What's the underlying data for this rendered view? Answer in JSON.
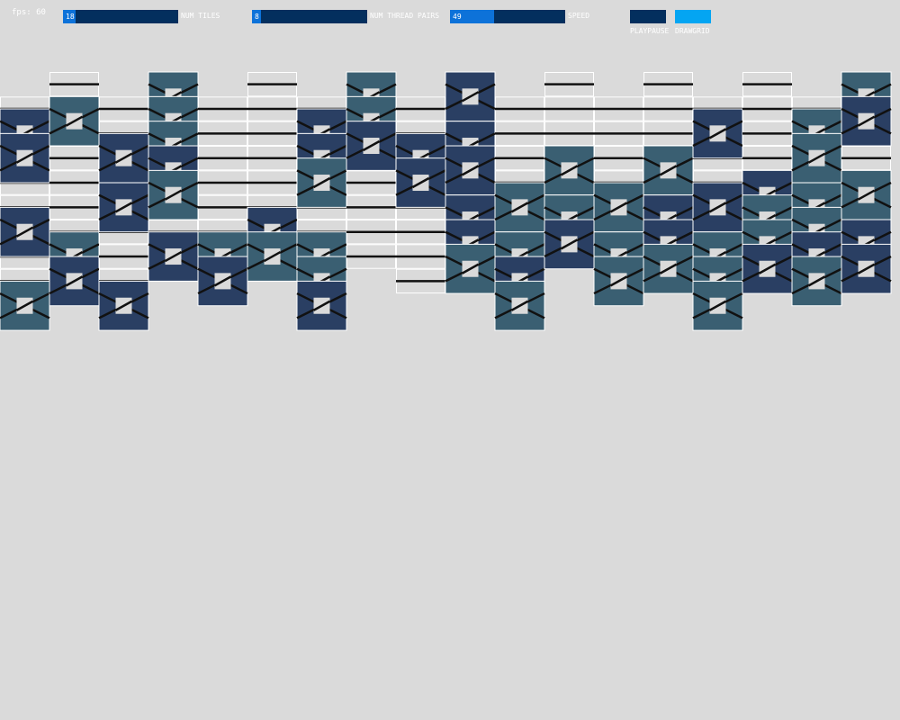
{
  "fps": "fps: 60",
  "sliders": [
    {
      "label": "NUM TILES",
      "value": "18",
      "fraction": 0.11
    },
    {
      "label": "NUM THREAD PAIRS",
      "value": "8",
      "fraction": 0.08
    },
    {
      "label": "SPEED",
      "value": "49",
      "fraction": 0.38
    }
  ],
  "toggles": [
    {
      "label": "PLAYPAUSE",
      "color": "#032f5e"
    },
    {
      "label": "DRAWGRID",
      "color": "#04a5f2"
    }
  ],
  "colors": {
    "background": "#dadada",
    "tile_dark": "#2a3f63",
    "tile_teal": "#3a5f72",
    "thread": "#111111",
    "grid": "#ffffff"
  },
  "grid": {
    "columns": [
      {
        "offset": 1,
        "tiles": [
          [
            1,
            "d"
          ],
          [
            3,
            "d"
          ],
          [
            9,
            "d"
          ],
          [
            15,
            "t"
          ]
        ]
      },
      {
        "offset": 0,
        "tiles": [
          [
            2,
            "t"
          ],
          [
            13,
            "t"
          ],
          [
            15,
            "d"
          ]
        ]
      },
      {
        "offset": 1,
        "tiles": [
          [
            3,
            "d"
          ],
          [
            7,
            "d"
          ],
          [
            15,
            "d"
          ]
        ]
      },
      {
        "offset": 0,
        "tiles": [
          [
            0,
            "t"
          ],
          [
            2,
            "t"
          ],
          [
            4,
            "t"
          ],
          [
            6,
            "d"
          ],
          [
            8,
            "t"
          ],
          [
            13,
            "d"
          ]
        ]
      },
      {
        "offset": 1,
        "tiles": [
          [
            11,
            "t"
          ],
          [
            13,
            "d"
          ]
        ]
      },
      {
        "offset": 0,
        "tiles": [
          [
            11,
            "d"
          ],
          [
            13,
            "t"
          ]
        ]
      },
      {
        "offset": 1,
        "tiles": [
          [
            1,
            "d"
          ],
          [
            3,
            "d"
          ],
          [
            5,
            "t"
          ],
          [
            11,
            "t"
          ],
          [
            13,
            "t"
          ],
          [
            15,
            "d"
          ]
        ]
      },
      {
        "offset": 0,
        "tiles": [
          [
            0,
            "t"
          ],
          [
            2,
            "t"
          ],
          [
            4,
            "d"
          ]
        ]
      },
      {
        "offset": 1,
        "tiles": [
          [
            3,
            "d"
          ],
          [
            5,
            "d"
          ]
        ]
      },
      {
        "offset": 0,
        "tiles": [
          [
            0,
            "d"
          ],
          [
            4,
            "d"
          ],
          [
            6,
            "d"
          ],
          [
            10,
            "d"
          ],
          [
            12,
            "d"
          ],
          [
            14,
            "t"
          ]
        ]
      },
      {
        "offset": 1,
        "tiles": [
          [
            7,
            "t"
          ],
          [
            11,
            "t"
          ],
          [
            13,
            "d"
          ],
          [
            15,
            "t"
          ]
        ]
      },
      {
        "offset": 0,
        "tiles": [
          [
            6,
            "t"
          ],
          [
            10,
            "t"
          ],
          [
            12,
            "d"
          ]
        ]
      },
      {
        "offset": 1,
        "tiles": [
          [
            7,
            "t"
          ],
          [
            11,
            "t"
          ],
          [
            13,
            "t"
          ]
        ]
      },
      {
        "offset": 0,
        "tiles": [
          [
            6,
            "t"
          ],
          [
            10,
            "d"
          ],
          [
            12,
            "d"
          ],
          [
            14,
            "t"
          ]
        ]
      },
      {
        "offset": 1,
        "tiles": [
          [
            1,
            "d"
          ],
          [
            7,
            "d"
          ],
          [
            11,
            "t"
          ],
          [
            13,
            "t"
          ],
          [
            15,
            "t"
          ]
        ]
      },
      {
        "offset": 0,
        "tiles": [
          [
            8,
            "d"
          ],
          [
            10,
            "t"
          ],
          [
            12,
            "t"
          ],
          [
            14,
            "d"
          ]
        ]
      },
      {
        "offset": 1,
        "tiles": [
          [
            1,
            "t"
          ],
          [
            3,
            "t"
          ],
          [
            7,
            "t"
          ],
          [
            9,
            "t"
          ],
          [
            11,
            "d"
          ],
          [
            13,
            "t"
          ]
        ]
      },
      {
        "offset": 0,
        "tiles": [
          [
            0,
            "t"
          ],
          [
            2,
            "d"
          ],
          [
            8,
            "t"
          ],
          [
            12,
            "d"
          ],
          [
            14,
            "d"
          ]
        ]
      }
    ]
  }
}
